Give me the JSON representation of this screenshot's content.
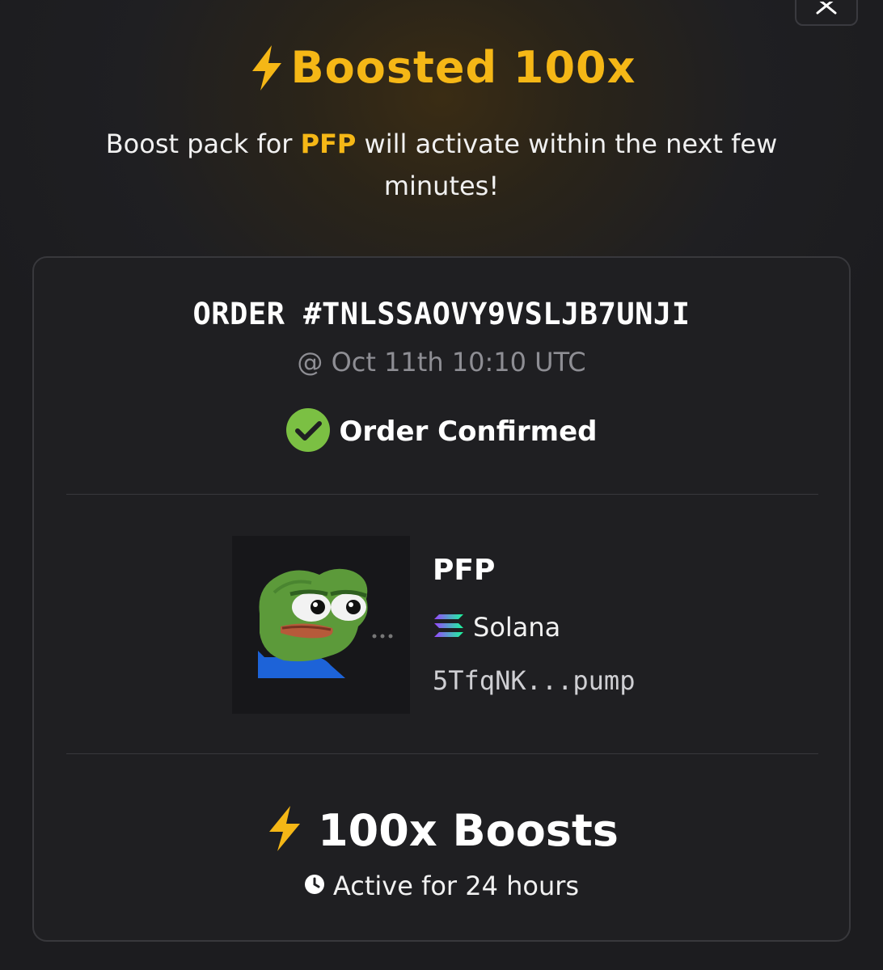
{
  "header": {
    "title": "Boosted 100x",
    "subtitle_prefix": "Boost pack for ",
    "subtitle_token": "PFP",
    "subtitle_suffix": " will activate within the next few minutes!",
    "close_icon": "close-icon"
  },
  "order": {
    "id": "ORDER #TNLSSAOVY9VSLJB7UNJI",
    "time": "@ Oct 11th 10:10 UTC",
    "status": "Order Confirmed",
    "status_icon": "check-circle-icon"
  },
  "token": {
    "name": "PFP",
    "chain": "Solana",
    "chain_icon": "solana-icon",
    "address": "5TfqNK...pump",
    "image": "pepe-frog-avatar"
  },
  "boost": {
    "label": "100x Boosts",
    "duration": "Active for 24 hours",
    "icon": "lightning-bolt-icon",
    "duration_icon": "clock-icon"
  },
  "colors": {
    "accent": "#f5b716",
    "success": "#7bc043",
    "card_bg": "#1f1f22",
    "card_border": "#38383c"
  }
}
